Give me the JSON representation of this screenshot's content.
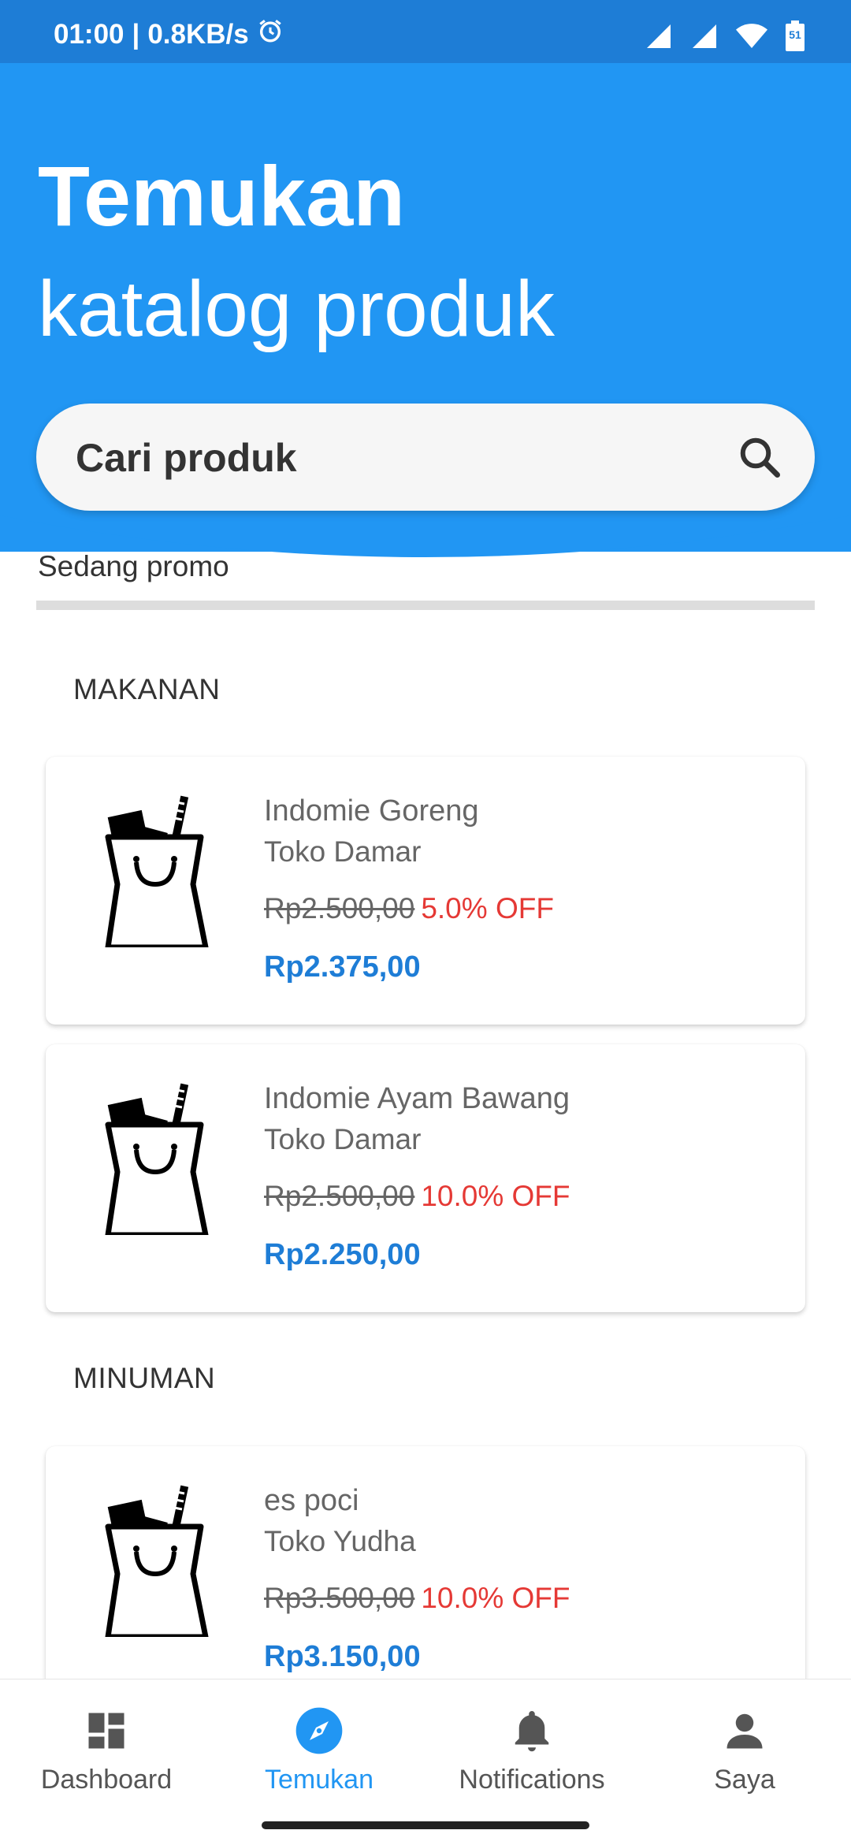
{
  "status_bar": {
    "time": "01:00",
    "speed": "0.8KB/s",
    "battery_level": "51"
  },
  "header": {
    "title_line1": "Temukan",
    "title_line2": "katalog produk"
  },
  "search": {
    "placeholder": "Cari produk"
  },
  "promo": {
    "label": "Sedang promo"
  },
  "sections": [
    {
      "title": "MAKANAN",
      "products": [
        {
          "name": "Indomie Goreng",
          "shop": "Toko Damar",
          "old_price": "Rp2.500,00",
          "discount": "5.0% OFF",
          "price": "Rp2.375,00"
        },
        {
          "name": "Indomie Ayam Bawang",
          "shop": "Toko Damar",
          "old_price": "Rp2.500,00",
          "discount": "10.0% OFF",
          "price": "Rp2.250,00"
        }
      ]
    },
    {
      "title": "MINUMAN",
      "products": [
        {
          "name": "es poci",
          "shop": "Toko Yudha",
          "old_price": "Rp3.500,00",
          "discount": "10.0% OFF",
          "price": "Rp3.150,00"
        }
      ]
    }
  ],
  "bottom_nav": {
    "items": [
      {
        "label": "Dashboard",
        "icon": "dashboard-icon"
      },
      {
        "label": "Temukan",
        "icon": "compass-icon"
      },
      {
        "label": "Notifications",
        "icon": "bell-icon"
      },
      {
        "label": "Saya",
        "icon": "person-icon"
      }
    ],
    "active": "Temukan"
  },
  "colors": {
    "primary": "#2196F3",
    "status_bar": "#1E7DD6",
    "discount": "#E53935",
    "price": "#1E7DD6"
  }
}
